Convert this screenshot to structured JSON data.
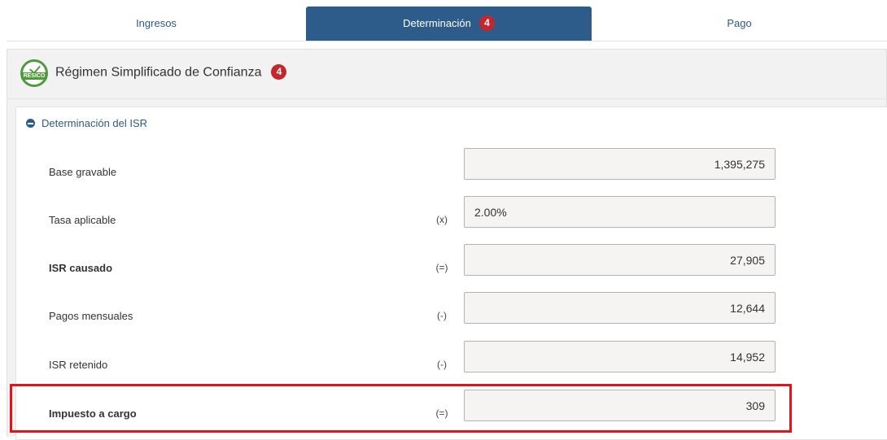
{
  "tabs": [
    {
      "label": "Ingresos"
    },
    {
      "label": "Determinación",
      "badge": "4"
    },
    {
      "label": "Pago"
    }
  ],
  "section": {
    "logo_text": "RESICO",
    "title": "Régimen Simplificado de Confianza",
    "badge": "4"
  },
  "card": {
    "title": "Determinación del ISR",
    "rows": [
      {
        "label": "Base gravable",
        "operator": "",
        "value": "1,395,275"
      },
      {
        "label": "Tasa aplicable",
        "operator": "(x)",
        "value": "2.00%"
      },
      {
        "label": "ISR causado",
        "operator": "(=)",
        "value": "27,905"
      },
      {
        "label": "Pagos mensuales",
        "operator": "(-)",
        "value": "12,644"
      },
      {
        "label": "ISR retenido",
        "operator": "(-)",
        "value": "14,952"
      },
      {
        "label": "Impuesto a cargo",
        "operator": "(=)",
        "value": "309"
      }
    ]
  },
  "colors": {
    "active_tab": "#2d5c8a",
    "badge": "#c4262e",
    "highlight": "#e0141a",
    "logo": "#4f9a3c"
  }
}
